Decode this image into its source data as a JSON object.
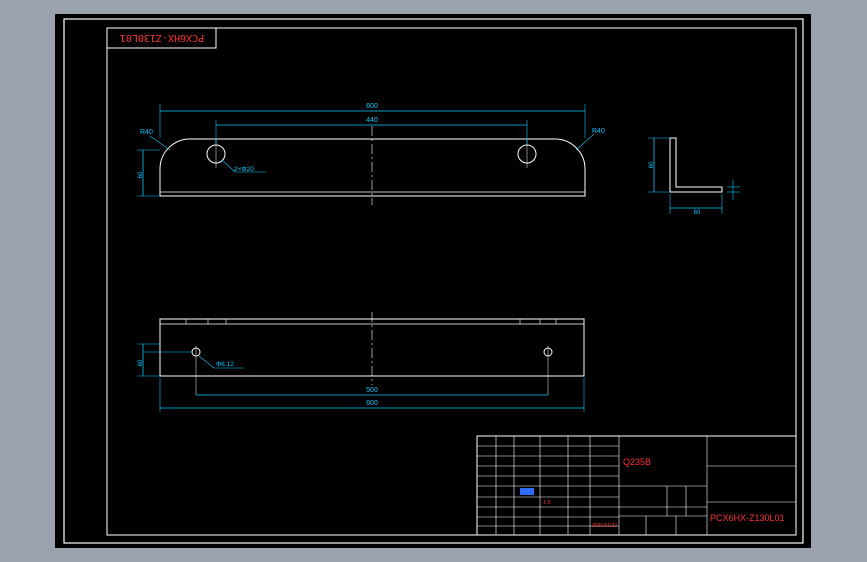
{
  "colors": {
    "outer_bg": "#9aa3ad",
    "sheet": "#000000",
    "frame": "#ffffff",
    "cyan": "#00c8ff",
    "blue": "#2f6bff",
    "red": "#ff3030",
    "pink": "#ff66cc",
    "yellow": "#ffff33"
  },
  "drawing": {
    "stamp": "PCX6HX-Z130L01",
    "dims": {
      "top_overall": "600",
      "top_holes": "440",
      "radius_left": "R40",
      "radius_right": "R40",
      "top_height": "60",
      "hole_note": "2×Φ20",
      "side_height": "60",
      "side_width": "60",
      "bottom_hole_note": "Φ8.12",
      "bottom_height": "60",
      "bottom_holes": "500",
      "bottom_overall": "600"
    }
  },
  "title_block": {
    "material": "Q235B",
    "company": "",
    "part_name": "",
    "drawing_number": "PCX6HX-Z130L01",
    "scale_label": "",
    "scale_value": "",
    "weight_label": "",
    "weight_value": "",
    "sheet_label": "",
    "ratio_value": "1:5",
    "date_value": "2021/01/22",
    "stage_label": "",
    "stage_value": "",
    "sheet_total": "",
    "sheet_num": "",
    "rows": [
      [
        "",
        "",
        "",
        "",
        "",
        ""
      ],
      [
        "",
        "",
        "",
        "",
        "",
        ""
      ],
      [
        "",
        "",
        "",
        "",
        "",
        ""
      ],
      [
        "",
        "",
        "",
        "",
        "",
        ""
      ],
      [
        "",
        "",
        "",
        "",
        "",
        ""
      ],
      [
        "",
        "",
        "",
        "",
        "",
        ""
      ]
    ]
  }
}
